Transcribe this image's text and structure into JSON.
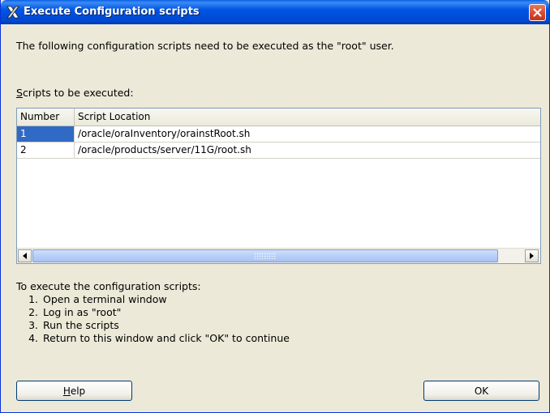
{
  "window": {
    "title": "Execute Configuration scripts"
  },
  "intro_text": "The following configuration scripts need to be executed as the \"root\" user.",
  "scripts_label": {
    "accel": "S",
    "rest": "cripts to be executed:"
  },
  "table": {
    "columns": [
      "Number",
      "Script Location"
    ],
    "rows": [
      {
        "number": "1",
        "location": "/oracle/oraInventory/orainstRoot.sh",
        "selected": true
      },
      {
        "number": "2",
        "location": "/oracle/products/server/11G/root.sh",
        "selected": false
      }
    ]
  },
  "instructions": {
    "heading": "To execute the configuration scripts:",
    "steps": [
      "Open a terminal window",
      "Log in as \"root\"",
      "Run the scripts",
      "Return to this window and click \"OK\" to continue"
    ]
  },
  "buttons": {
    "help": {
      "accel": "H",
      "rest": "elp"
    },
    "ok": "OK"
  },
  "icons": {
    "title": "x-logo-icon",
    "close": "close-icon",
    "scroll_left": "arrow-left-icon",
    "scroll_right": "arrow-right-icon"
  },
  "colors": {
    "titlebar": "#0054e3",
    "selection": "#316ac5",
    "close_button": "#d8462a"
  }
}
